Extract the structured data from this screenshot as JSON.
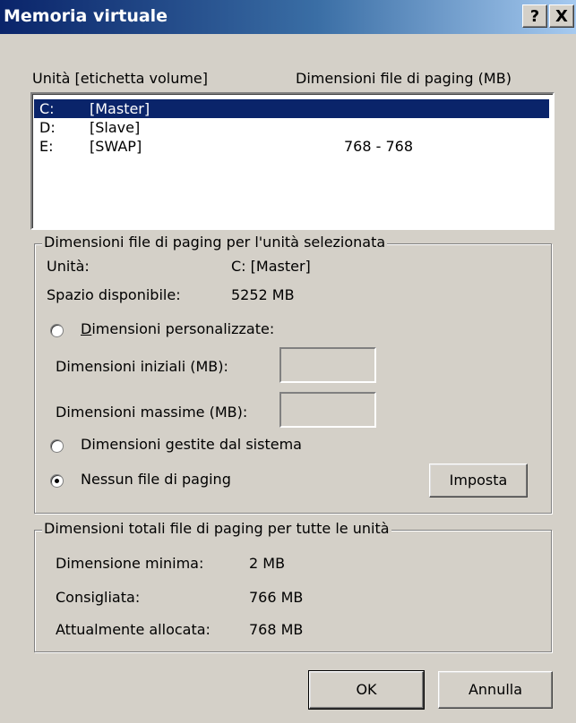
{
  "window": {
    "title": "Memoria virtuale",
    "help_label": "?",
    "close_label": "X"
  },
  "list": {
    "col_drive": "Unità [etichetta volume]",
    "col_size": "Dimensioni file di paging (MB)",
    "rows": [
      {
        "drive": "C:",
        "label": "[Master]",
        "size": ""
      },
      {
        "drive": "D:",
        "label": "[Slave]",
        "size": ""
      },
      {
        "drive": "E:",
        "label": "[SWAP]",
        "size": "768 - 768"
      }
    ]
  },
  "selected": {
    "group_title": "Dimensioni file di paging per l'unità selezionata",
    "drive_label": "Unità:",
    "drive_value": "C:  [Master]",
    "space_label": "Spazio disponibile:",
    "space_value": "5252 MB",
    "custom_label": "Dimensioni personalizzate:",
    "initial_label": "Dimensioni iniziali (MB):",
    "initial_value": "",
    "max_label": "Dimensioni massime (MB):",
    "max_value": "",
    "system_label": "Dimensioni gestite dal sistema",
    "none_label": "Nessun file di paging",
    "set_button": "Imposta",
    "selected_option": "none"
  },
  "totals": {
    "group_title": "Dimensioni totali file di paging per tutte le unità",
    "min_label": "Dimensione minima:",
    "min_value": "2 MB",
    "rec_label": "Consigliata:",
    "rec_value": "766 MB",
    "alloc_label": "Attualmente allocata:",
    "alloc_value": "768 MB"
  },
  "buttons": {
    "ok": "OK",
    "cancel": "Annulla"
  }
}
